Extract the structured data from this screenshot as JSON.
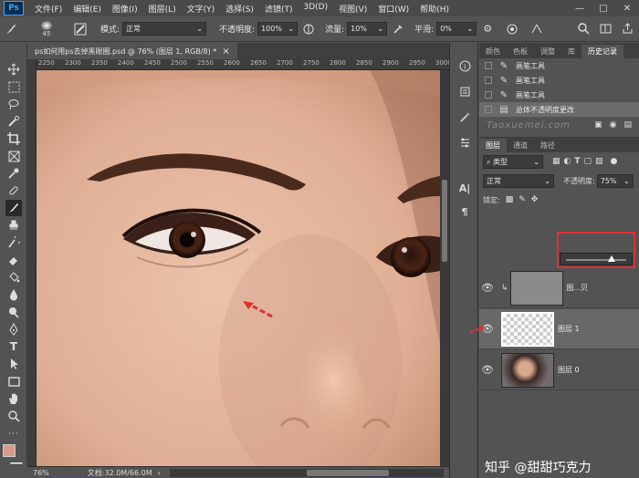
{
  "menubar": {
    "logo": "Ps",
    "items": [
      "文件(F)",
      "编辑(E)",
      "图像(I)",
      "图层(L)",
      "文字(Y)",
      "选择(S)",
      "滤镜(T)",
      "3D(D)",
      "视图(V)",
      "窗口(W)",
      "帮助(H)"
    ],
    "window_controls": [
      "—",
      "□",
      "✕"
    ]
  },
  "options_bar": {
    "brush_size": "45",
    "mode_label": "模式:",
    "mode_value": "正常",
    "opacity_label": "不透明度:",
    "opacity_value": "100%",
    "flow_label": "流量:",
    "flow_value": "10%",
    "smoothing_label": "平滑:",
    "smoothing_value": "0%"
  },
  "document": {
    "tab_title": "ps如何用ps去掉黑眼圈.psd @ 76% (图层 1, RGB/8) *",
    "close": "×"
  },
  "ruler": {
    "ticks": [
      "2250",
      "2300",
      "2350",
      "2400",
      "2450",
      "2500",
      "2550",
      "2600",
      "2650",
      "2700",
      "2750",
      "2800",
      "2850",
      "2900",
      "2950",
      "3000"
    ]
  },
  "status_bar": {
    "zoom": "76%",
    "doc_info": "文档:32.0M/66.0M"
  },
  "history_panel": {
    "tabs": [
      "颜色",
      "色板",
      "调整",
      "库",
      "历史记录"
    ],
    "active_tab": 4,
    "items": [
      {
        "label": "画笔工具",
        "icon": "brush-icon"
      },
      {
        "label": "画笔工具",
        "icon": "brush-icon"
      },
      {
        "label": "画笔工具",
        "icon": "brush-icon"
      },
      {
        "label": "总体不透明度更改",
        "icon": "document-icon"
      }
    ],
    "watermark": "Taoxuemei.com"
  },
  "layers_panel": {
    "tabs": [
      "图层",
      "通道",
      "路径"
    ],
    "active_tab": 0,
    "filter_label": "类型",
    "blend_mode": "正常",
    "opacity_label": "不透明度:",
    "opacity_value": "75%",
    "opacity_level": 0.75,
    "lock_label": "锁定:",
    "layers": [
      {
        "name": "图...贝",
        "clipped": true,
        "selected": false
      },
      {
        "name": "图层 1",
        "clipped": false,
        "selected": true
      },
      {
        "name": "图层 0",
        "clipped": false,
        "selected": false
      }
    ]
  },
  "footer_watermark": "知乎 @甜甜巧克力",
  "colors": {
    "foreground": "#d89a8b",
    "background": "#ffffff",
    "highlight_box": "#e03030",
    "arrow": "#e03030",
    "ps_blue": "#31a8ff"
  }
}
